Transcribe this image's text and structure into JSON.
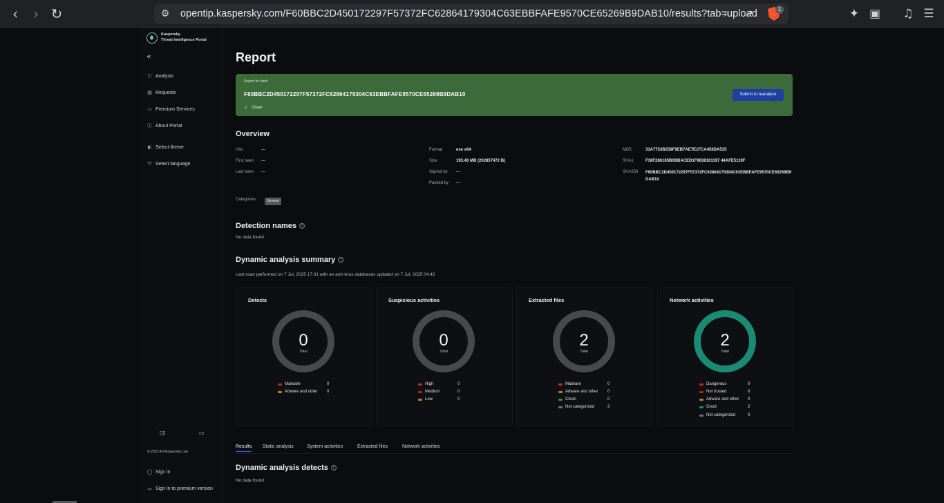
{
  "browser": {
    "url": "opentip.kaspersky.com/F60BBC2D450172297F57372FC62864179304C63EBBFAFE9570CE65269B9DAB10/results?tab=upload",
    "brave_badge": "1",
    "icons": [
      "back-icon",
      "forward-icon",
      "reload-icon",
      "site-settings-icon",
      "zoom-icon",
      "share-icon",
      "brave-shield-icon",
      "extensions-icon",
      "wallet-icon",
      "media-icon",
      "menu-icon"
    ]
  },
  "sidebar": {
    "brand_line1": "Kaspersky",
    "brand_line2": "Threat Intelligence Portal",
    "collapse": "«",
    "items": [
      {
        "label": "Analysis",
        "icon": "cube-icon"
      },
      {
        "label": "Requests",
        "icon": "document-icon"
      },
      {
        "label": "Premium Services",
        "icon": "briefcase-icon"
      },
      {
        "label": "About Portal",
        "icon": "info-icon"
      },
      {
        "label": "Select theme",
        "icon": "theme-icon"
      },
      {
        "label": "Select language",
        "icon": "language-icon"
      }
    ],
    "copyright": "© 2025 AO Kaspersky Lab",
    "sign_in": "Sign in",
    "sign_in_premium": "Sign in to premium version"
  },
  "report": {
    "title": "Report",
    "banner_caption": "Report for hash",
    "hash": "F60BBC2D450172297F57372FC62864179304C63EBBFAFE9570CE65269B9DAB10",
    "status": "Clean",
    "reanalyze_label": "Submit to reanalyze",
    "banner_color": "#3c6a3a"
  },
  "overview": {
    "title": "Overview",
    "hits_label": "Hits",
    "hits": "—",
    "first_seen_label": "First seen",
    "first_seen": "—",
    "last_seen_label": "Last seen",
    "last_seen": "—",
    "format_label": "Format",
    "format": "exe x64",
    "size_label": "Size",
    "size": "193.46 MB (202857472 B)",
    "signed_by_label": "Signed by",
    "signed_by": "—",
    "packed_by_label": "Packed by",
    "packed_by": "—",
    "md5_label": "MD5",
    "md5": "33A7733B258F9EB7AE7E1FCA458DA535",
    "sha1_label": "SHA1",
    "sha1": "F38F286185B0BBACED1F9838161197 44AFE5119F",
    "sha256_label": "SHA256",
    "sha256": "F60BBC2D450172297F57372FC62864179304C63EBBFAFE9570CE65269B9DAB10",
    "categories_label": "Categories",
    "category": "General"
  },
  "detection": {
    "title": "Detection names",
    "empty": "No data found"
  },
  "dynamic": {
    "title": "Dynamic analysis summary",
    "note": "Last scan performed on 7 Jul, 2025 17:31 with an anti-virus databases updated on 7 Jul, 2025 04:42",
    "total_label": "Total",
    "cards": [
      {
        "title": "Detects",
        "total": "0",
        "ring_color": "#47494d",
        "legend": [
          {
            "label": "Malware",
            "value": "0",
            "color": "#c62828"
          },
          {
            "label": "Adware and other",
            "value": "0",
            "color": "#c77a15"
          }
        ]
      },
      {
        "title": "Suspicious activities",
        "total": "0",
        "ring_color": "#47494d",
        "legend": [
          {
            "label": "High",
            "value": "0",
            "color": "#c62828"
          },
          {
            "label": "Medium",
            "value": "0",
            "color": "#b71c1c"
          },
          {
            "label": "Low",
            "value": "0",
            "color": "#c77a15"
          }
        ]
      },
      {
        "title": "Extracted files",
        "total": "2",
        "ring_color": "#47494d",
        "legend": [
          {
            "label": "Malware",
            "value": "0",
            "color": "#c62828"
          },
          {
            "label": "Adware and other",
            "value": "0",
            "color": "#c77a15"
          },
          {
            "label": "Clean",
            "value": "0",
            "color": "#1b8a72"
          },
          {
            "label": "Not categorized",
            "value": "2",
            "color": "#6d6f73"
          }
        ]
      },
      {
        "title": "Network activities",
        "total": "2",
        "ring_color": "#1b8a72",
        "legend": [
          {
            "label": "Dangerous",
            "value": "0",
            "color": "#c62828"
          },
          {
            "label": "Not trusted",
            "value": "0",
            "color": "#b71c1c"
          },
          {
            "label": "Adware and other",
            "value": "0",
            "color": "#c77a15"
          },
          {
            "label": "Good",
            "value": "2",
            "color": "#1b8a72"
          },
          {
            "label": "Not categorized",
            "value": "0",
            "color": "#6d6f73"
          }
        ]
      }
    ]
  },
  "tabs": [
    "Results",
    "Static analysis",
    "System activities",
    "Extracted files",
    "Network activities"
  ],
  "detects": {
    "title": "Dynamic analysis detects",
    "empty": "No data found"
  }
}
